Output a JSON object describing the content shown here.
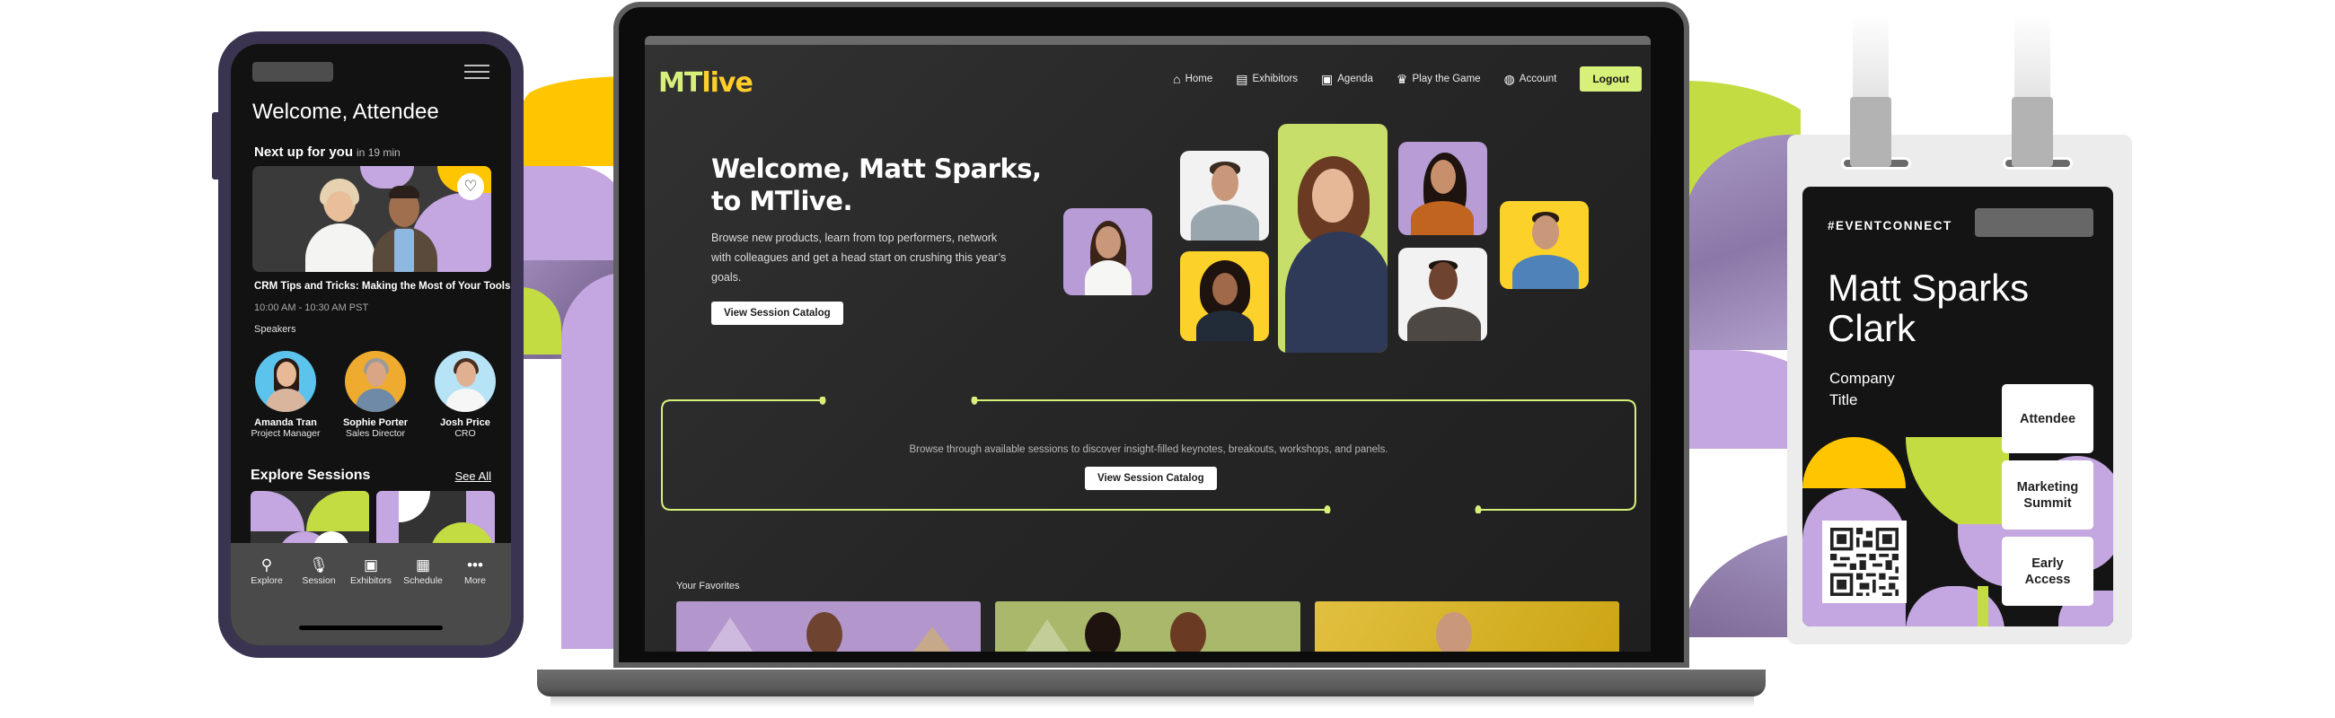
{
  "colors": {
    "lavender": "#c4a6e0",
    "lime": "#c3dc41",
    "yellow": "#ffc600",
    "logo_mt": "#d7f07a",
    "logo_live": "#ffce2a",
    "phone_frame": "#3a3451"
  },
  "phone": {
    "welcome": "Welcome, Attendee",
    "next_up_label": "Next up for you",
    "next_up_time": "in 19 min",
    "favorite_icon": "heart-icon",
    "session": {
      "title": "CRM Tips and Tricks: Making the Most of Your Tools",
      "time": "10:00 AM - 10:30 AM PST"
    },
    "speakers_label": "Speakers",
    "speakers": [
      {
        "name": "Amanda Tran",
        "role": "Project Manager"
      },
      {
        "name": "Sophie Porter",
        "role": "Sales Director"
      },
      {
        "name": "Josh Price",
        "role": "CRO"
      }
    ],
    "explore_title": "Explore Sessions",
    "see_all": "See All",
    "nav": [
      {
        "label": "Explore",
        "icon": "search-icon",
        "glyph": "⚲"
      },
      {
        "label": "Session",
        "icon": "microphone-icon",
        "glyph": "🎙"
      },
      {
        "label": "Exhibitors",
        "icon": "exhibitors-icon",
        "glyph": "▣"
      },
      {
        "label": "Schedule",
        "icon": "calendar-icon",
        "glyph": "▦"
      },
      {
        "label": "More",
        "icon": "more-icon",
        "glyph": "•••"
      }
    ]
  },
  "laptop": {
    "logo_mt": "MT",
    "logo_live": "live",
    "nav": [
      {
        "label": "Home",
        "icon": "home-icon",
        "glyph": "⌂"
      },
      {
        "label": "Exhibitors",
        "icon": "storefront-icon",
        "glyph": "▤"
      },
      {
        "label": "Agenda",
        "icon": "calendar-icon",
        "glyph": "▣"
      },
      {
        "label": "Play the Game",
        "icon": "trophy-icon",
        "glyph": "♛"
      },
      {
        "label": "Account",
        "icon": "account-globe-icon",
        "glyph": "◍"
      }
    ],
    "logout": "Logout",
    "hero": {
      "title_line1": "Welcome, Matt Sparks,",
      "title_line2": "to MTlive.",
      "description": "Browse new products, learn from top performers, network with colleagues and get a head start on crushing this year’s goals.",
      "button": "View Session Catalog"
    },
    "catalog_banner": {
      "text": "Browse through available sessions to discover insight-filled keynotes, breakouts, workshops, and panels.",
      "button": "View Session Catalog"
    },
    "favorites_label": "Your Favorites"
  },
  "badge": {
    "hashtag": "#EVENTCONNECT",
    "name_line1": "Matt Sparks",
    "name_line2": "Clark",
    "company": "Company",
    "title": "Title",
    "tags": [
      "Attendee",
      "Marketing Summit",
      "Early Access"
    ]
  }
}
